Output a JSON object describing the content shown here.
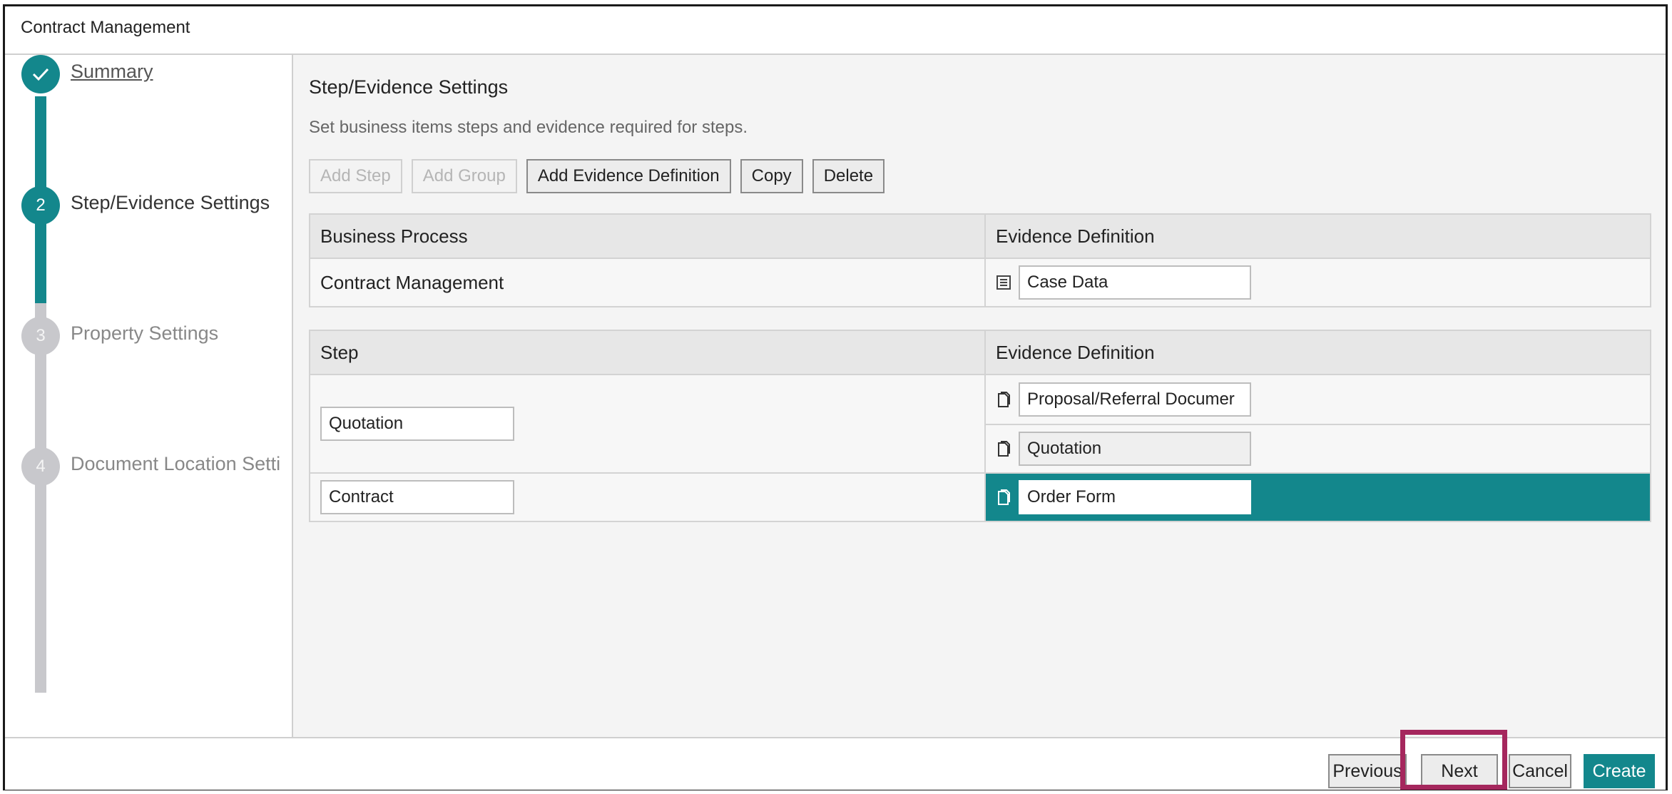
{
  "window": {
    "title": "Contract Management"
  },
  "wizard": {
    "steps": [
      {
        "number": "",
        "label": "Summary",
        "state": "done"
      },
      {
        "number": "2",
        "label": "Step/Evidence Settings",
        "state": "current"
      },
      {
        "number": "3",
        "label": "Property Settings",
        "state": "todo"
      },
      {
        "number": "4",
        "label": "Document Location Setti",
        "state": "todo"
      }
    ]
  },
  "main": {
    "title": "Step/Evidence Settings",
    "description": "Set business items steps and evidence required for steps.",
    "toolbar": {
      "add_step": "Add Step",
      "add_group": "Add Group",
      "add_evidence_definition": "Add Evidence Definition",
      "copy": "Copy",
      "delete": "Delete"
    },
    "process_table": {
      "headers": [
        "Business Process",
        "Evidence Definition"
      ],
      "row": {
        "process": "Contract Management",
        "evidence": "Case Data"
      }
    },
    "step_table": {
      "headers": [
        "Step",
        "Evidence Definition"
      ],
      "rows": [
        {
          "step": "Quotation",
          "evidence": [
            "Proposal/Referral Documer",
            "Quotation"
          ]
        },
        {
          "step": "Contract",
          "evidence": [
            "Order Form"
          ]
        }
      ]
    }
  },
  "footer": {
    "previous": "Previous",
    "next": "Next",
    "cancel": "Cancel",
    "create": "Create"
  },
  "colors": {
    "accent": "#13878c",
    "highlight": "#a5275d",
    "inactive_rail": "#c8c8cc"
  }
}
